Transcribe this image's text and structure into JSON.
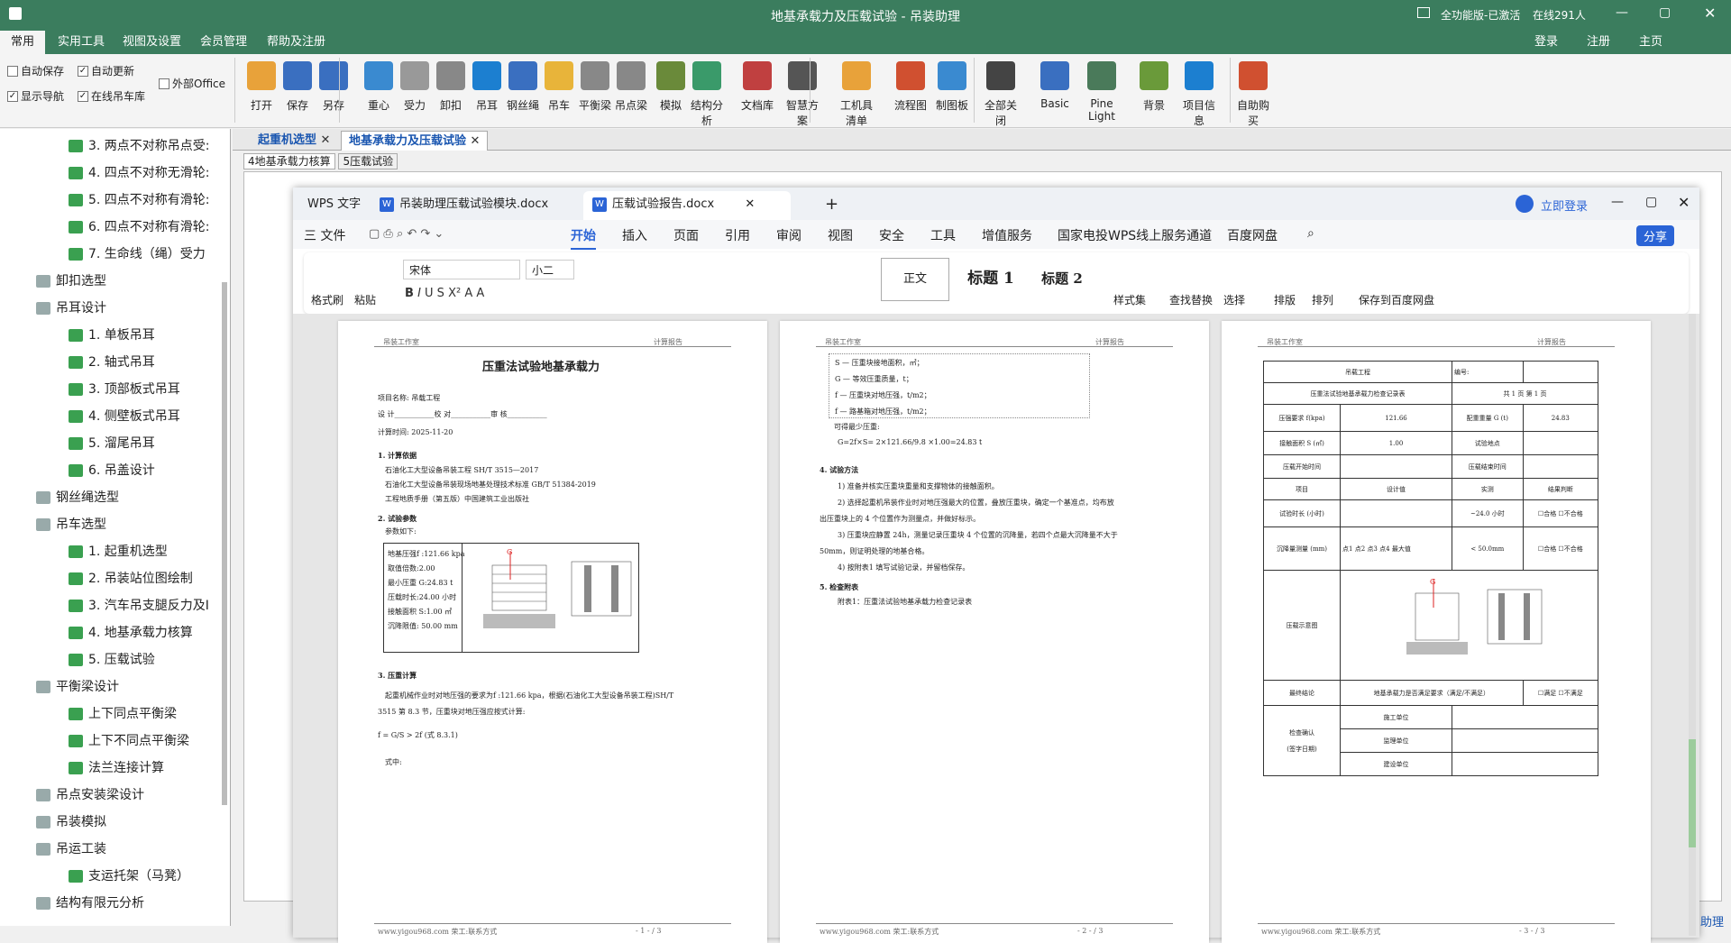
{
  "titlebar": {
    "title": "地基承载力及压载试验 - 吊装助理",
    "status": "全功能版-已激活",
    "online": "在线291人"
  },
  "menubar": {
    "tabs": [
      "常用",
      "实用工具",
      "视图及设置",
      "会员管理",
      "帮助及注册"
    ],
    "right": [
      "登录",
      "注册",
      "主页"
    ]
  },
  "ribbon": {
    "checks": [
      {
        "label": "自动保存",
        "checked": false
      },
      {
        "label": "自动更新",
        "checked": true
      },
      {
        "label": "外部Office",
        "checked": false
      },
      {
        "label": "显示导航",
        "checked": true
      },
      {
        "label": "在线吊车库",
        "checked": true
      }
    ],
    "buttons": [
      "打开",
      "保存",
      "另存",
      "重心",
      "受力",
      "卸扣",
      "吊耳",
      "钢丝绳",
      "吊车",
      "平衡梁",
      "吊点梁",
      "模拟",
      "结构分析",
      "文档库",
      "智慧方案",
      "工机具清单",
      "流程图",
      "制图板",
      "全部关闭",
      "Basic",
      "Pine Light",
      "背景",
      "项目信息",
      "自助购买"
    ]
  },
  "tree": [
    {
      "label": "3. 两点不对称吊点受:",
      "indent": 3
    },
    {
      "label": "4. 四点不对称无滑轮:",
      "indent": 3
    },
    {
      "label": "5. 四点不对称有滑轮:",
      "indent": 3
    },
    {
      "label": "6. 四点不对称有滑轮:",
      "indent": 3
    },
    {
      "label": "7. 生命线（绳）受力",
      "indent": 3
    },
    {
      "label": "卸扣选型",
      "indent": 2
    },
    {
      "label": "吊耳设计",
      "indent": 2
    },
    {
      "label": "1. 单板吊耳",
      "indent": 3
    },
    {
      "label": "2. 轴式吊耳",
      "indent": 3
    },
    {
      "label": "3. 顶部板式吊耳",
      "indent": 3
    },
    {
      "label": "4. 侧壁板式吊耳",
      "indent": 3
    },
    {
      "label": "5. 溜尾吊耳",
      "indent": 3
    },
    {
      "label": "6. 吊盖设计",
      "indent": 3
    },
    {
      "label": "钢丝绳选型",
      "indent": 2
    },
    {
      "label": "吊车选型",
      "indent": 2
    },
    {
      "label": "1. 起重机选型",
      "indent": 3
    },
    {
      "label": "2. 吊装站位图绘制",
      "indent": 3
    },
    {
      "label": "3. 汽车吊支腿反力及I",
      "indent": 3
    },
    {
      "label": "4. 地基承载力核算",
      "indent": 3
    },
    {
      "label": "5. 压载试验",
      "indent": 3
    },
    {
      "label": "平衡梁设计",
      "indent": 2
    },
    {
      "label": "上下同点平衡梁",
      "indent": 3
    },
    {
      "label": "上下不同点平衡梁",
      "indent": 3
    },
    {
      "label": "法兰连接计算",
      "indent": 3
    },
    {
      "label": "吊点安装梁设计",
      "indent": 2
    },
    {
      "label": "吊装模拟",
      "indent": 2
    },
    {
      "label": "吊运工装",
      "indent": 2
    },
    {
      "label": "支运托架（马凳）",
      "indent": 3
    },
    {
      "label": "结构有限元分析",
      "indent": 2
    }
  ],
  "doctabs": [
    "起重机选型",
    "地基承载力及压载试验"
  ],
  "subtabs": [
    "4地基承载力核算",
    "5压载试验"
  ],
  "wps": {
    "tabs": [
      "WPS 文字",
      "吊装助理压载试验模块.docx",
      "压载试验报告.docx"
    ],
    "login": "立即登录",
    "menu": [
      "三 文件",
      "开始",
      "插入",
      "页面",
      "引用",
      "审阅",
      "视图",
      "安全",
      "工具",
      "增值服务",
      "国家电投WPS线上服务通道",
      "百度网盘"
    ],
    "share": "分享",
    "font": "宋体",
    "size": "小二",
    "styles": [
      "正文",
      "标题 1",
      "标题 2"
    ],
    "tools": [
      "格式刷",
      "粘贴",
      "样式集",
      "查找替换",
      "选择",
      "排版",
      "排列",
      "保存到百度网盘"
    ]
  },
  "page1": {
    "header_left": "吊装工作室",
    "header_right": "计算报告",
    "title": "压重法试验地基承载力",
    "project": "项目名称: 吊载工程",
    "sign": "设  计___________校  对___________审  核___________",
    "time": "计算时间: 2025-11-20",
    "s1": "1. 计算依据",
    "refs": [
      "石油化工大型设备吊装工程       SH/T 3515—2017",
      "石油化工大型设备吊装现场地基处理技术标准 GB/T 51384-2019",
      "工程地质手册（第五版）中国建筑工业出版社"
    ],
    "s2": "2. 试验参数",
    "s2sub": "参数如下:",
    "params": [
      "地基压强f :121.66 kpa",
      "取值倍数:2.00",
      "最小压重 G:24.83 t",
      "压载时长:24.00 小时",
      "接触面积 S:1.00 ㎡",
      "沉降限值: 50.00 mm"
    ],
    "s3": "3. 压重计算",
    "s3text": "起重机械作业时对地压强的要求为f :121.66 kpa，根据(石油化工大型设备吊装工程)SH/T",
    "s3text2": "3515 第 8.3 节，压重块对地压强应按式计算:",
    "formula": "f = G/S > 2f   (式 8.3.1)",
    "s3end": "式中:",
    "footer": "www.yigou968.com 荣工:联系方式",
    "pageno": "- 1 - / 3"
  },
  "page2": {
    "header_left": "吊装工作室",
    "header_right": "计算报告",
    "rows": [
      "S  — 压重块接地面积，㎡；",
      "G  — 等效压重质量，t；",
      "f  — 压重块对地压强，t/m2；",
      "f  — 路基箱对地压强，t/m2；"
    ],
    "need": "可得最少压重:",
    "formula": "G=2f×S= 2×121.66/9.8 ×1.00=24.83 t",
    "s4": "4. 试验方法",
    "steps": [
      "1) 准备并核实压重块重量和支撑物体的接触面积。",
      "2) 选择起重机吊装作业时对地压强最大的位置，叠放压重块，确定一个基准点，均布放",
      "出压重块上的 4 个位置作为测量点，并做好标示。",
      "3) 压重块应静置 24h，测量记录压重块 4 个位置的沉降量，若四个点最大沉降量不大于",
      "50mm，则证明处理的地基合格。",
      "4) 按附表1 填写试验记录，并留档保存。"
    ],
    "s5": "5. 检查附表",
    "attach": "附表1：压重法试验地基承载力检查记录表",
    "footer": "www.yigou968.com 荣工:联系方式",
    "pageno": "- 2 - / 3"
  },
  "page3": {
    "header_left": "吊装工作室",
    "header_right": "计算报告",
    "project": "吊载工程",
    "number": "编号:",
    "form": "压重法试验地基承载力检查记录表",
    "pages": "共 1 页  第 1 页",
    "p_label": "压强要求 f(kpa)",
    "p_val": "121.66",
    "g_label": "配重重量 G (t)",
    "g_val": "24.83",
    "s_label": "接触面积 S (㎡)",
    "s_val": "1.00",
    "site": "试验地点",
    "start": "压载开始时间",
    "end": "压载结束时间",
    "item": "项目",
    "design": "设计值",
    "measure": "实测",
    "judge": "结果判断",
    "dur": "试验时长 (小时)",
    "dur_val": "~24.0 小时",
    "settle": "沉降量测量 (mm)",
    "pts": [
      "点1",
      "点2",
      "点3",
      "点4",
      "最大值"
    ],
    "limit": "< 50.0mm",
    "pass": "合格",
    "fail": "不合格",
    "diagram": "压载示意图",
    "conclusion": "最终结论",
    "conc_text": "地基承载力是否满足要求（满足/不满足）",
    "ok": "满足",
    "nok": "不满足",
    "confirm": "检查确认",
    "sign": "(签字日期)",
    "units": [
      "施工单位",
      "监理单位",
      "建设单位"
    ],
    "footer": "www.yigou968.com 荣工:联系方式",
    "pageno": "- 3 - / 3"
  },
  "status": {
    "help": "助理"
  }
}
